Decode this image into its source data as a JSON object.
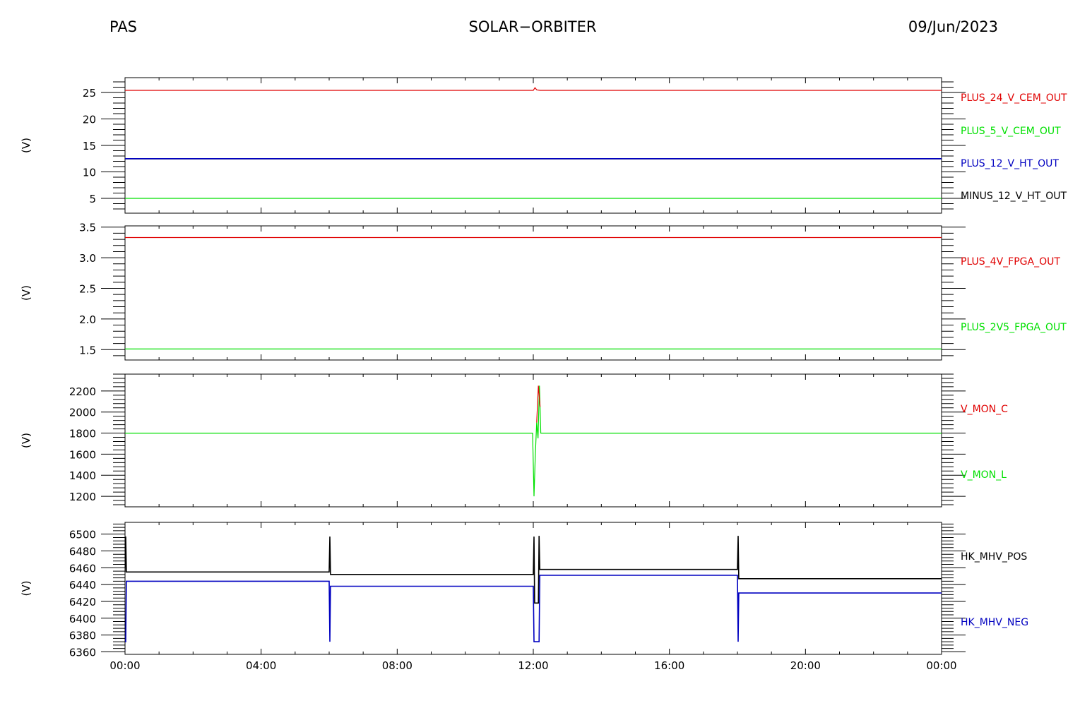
{
  "header": {
    "instrument": "PAS",
    "mission": "SOLAR−ORBITER",
    "date": "09/Jun/2023"
  },
  "colors": {
    "red": "#e00000",
    "green": "#00e000",
    "blue": "#0000c0",
    "black": "#000000"
  },
  "x_axis": {
    "ticks": [
      0,
      4,
      8,
      12,
      16,
      20,
      24
    ],
    "tick_labels": [
      "00:00",
      "04:00",
      "08:00",
      "12:00",
      "16:00",
      "20:00",
      "00:00"
    ],
    "range_hours": [
      0,
      24
    ]
  },
  "chart_data": [
    {
      "type": "line",
      "ylabel": "(V)",
      "ylim": [
        2.2,
        27.8
      ],
      "yticks": [
        5,
        10,
        15,
        20,
        25
      ],
      "ytick_labels": [
        "5",
        "10",
        "15",
        "20",
        "25"
      ],
      "legend_placement": "right",
      "series": [
        {
          "name": "PLUS_24_V_CEM_OUT",
          "color": "red",
          "x": [
            0,
            12.0,
            12.05,
            12.1,
            12.2,
            24
          ],
          "y": [
            25.4,
            25.4,
            25.9,
            25.5,
            25.4,
            25.4
          ]
        },
        {
          "name": "PLUS_5_V_CEM_OUT",
          "color": "green",
          "x": [
            0,
            24
          ],
          "y": [
            5.0,
            5.0
          ]
        },
        {
          "name": "PLUS_12_V_HT_OUT",
          "color": "blue",
          "x": [
            0,
            24
          ],
          "y": [
            12.5,
            12.5
          ]
        },
        {
          "name": "MINUS_12_V_HT_OUT",
          "color": "black",
          "x": [
            0,
            24
          ],
          "y": [
            12.45,
            12.45
          ]
        }
      ]
    },
    {
      "type": "line",
      "ylabel": "(V)",
      "ylim": [
        1.33,
        3.52
      ],
      "yticks": [
        1.5,
        2.0,
        2.5,
        3.0,
        3.5
      ],
      "ytick_labels": [
        "1.5",
        "2.0",
        "2.5",
        "3.0",
        "3.5"
      ],
      "legend_placement": "right",
      "series": [
        {
          "name": "PLUS_4V_FPGA_OUT",
          "color": "red",
          "x": [
            0,
            24
          ],
          "y": [
            3.33,
            3.33
          ]
        },
        {
          "name": "PLUS_2V5_FPGA_OUT",
          "color": "green",
          "x": [
            0,
            24
          ],
          "y": [
            1.51,
            1.51
          ]
        }
      ]
    },
    {
      "type": "line",
      "ylabel": "(V)",
      "ylim": [
        1100,
        2360
      ],
      "yticks": [
        1200,
        1400,
        1600,
        1800,
        2000,
        2200
      ],
      "ytick_labels": [
        "1200",
        "1400",
        "1600",
        "1800",
        "2000",
        "2200"
      ],
      "legend_placement": "right",
      "series": [
        {
          "name": "V_MON_C",
          "color": "red",
          "x": [
            12.1,
            12.15,
            12.2
          ],
          "y": [
            1900,
            2250,
            2050
          ]
        },
        {
          "name": "V_MON_L",
          "color": "green",
          "x": [
            0,
            11.98,
            12.02,
            12.06,
            12.1,
            12.14,
            12.18,
            12.22,
            24
          ],
          "y": [
            1800,
            1800,
            1200,
            1600,
            1900,
            1750,
            2250,
            1800,
            1800
          ]
        }
      ]
    },
    {
      "type": "line",
      "ylabel": "(V)",
      "ylim": [
        6357,
        6514
      ],
      "yticks": [
        6360,
        6380,
        6400,
        6420,
        6440,
        6460,
        6480,
        6500
      ],
      "ytick_labels": [
        "6360",
        "6380",
        "6400",
        "6420",
        "6440",
        "6460",
        "6480",
        "6500"
      ],
      "legend_placement": "right",
      "series": [
        {
          "name": "HK_MHV_POS",
          "color": "black",
          "x": [
            0,
            0.02,
            0.04,
            0.06,
            6.0,
            6.02,
            6.04,
            6.06,
            12.0,
            12.02,
            12.04,
            12.06,
            12.15,
            12.17,
            12.19,
            12.21,
            18.0,
            18.02,
            18.04,
            18.06,
            24
          ],
          "y": [
            6455,
            6497,
            6455,
            6455,
            6455,
            6497,
            6452,
            6452,
            6452,
            6497,
            6418,
            6418,
            6418,
            6498,
            6458,
            6458,
            6458,
            6498,
            6447,
            6447,
            6447
          ]
        },
        {
          "name": "HK_MHV_NEG",
          "color": "blue",
          "x": [
            0,
            0.02,
            0.04,
            0.06,
            6.0,
            6.02,
            6.04,
            6.06,
            12.0,
            12.02,
            12.04,
            12.06,
            12.15,
            12.17,
            12.19,
            12.21,
            18.0,
            18.02,
            18.04,
            18.06,
            24
          ],
          "y": [
            6372,
            6372,
            6444,
            6444,
            6444,
            6372,
            6438,
            6438,
            6438,
            6372,
            6372,
            6372,
            6372,
            6372,
            6451,
            6451,
            6451,
            6372,
            6430,
            6430,
            6430
          ]
        }
      ]
    }
  ]
}
